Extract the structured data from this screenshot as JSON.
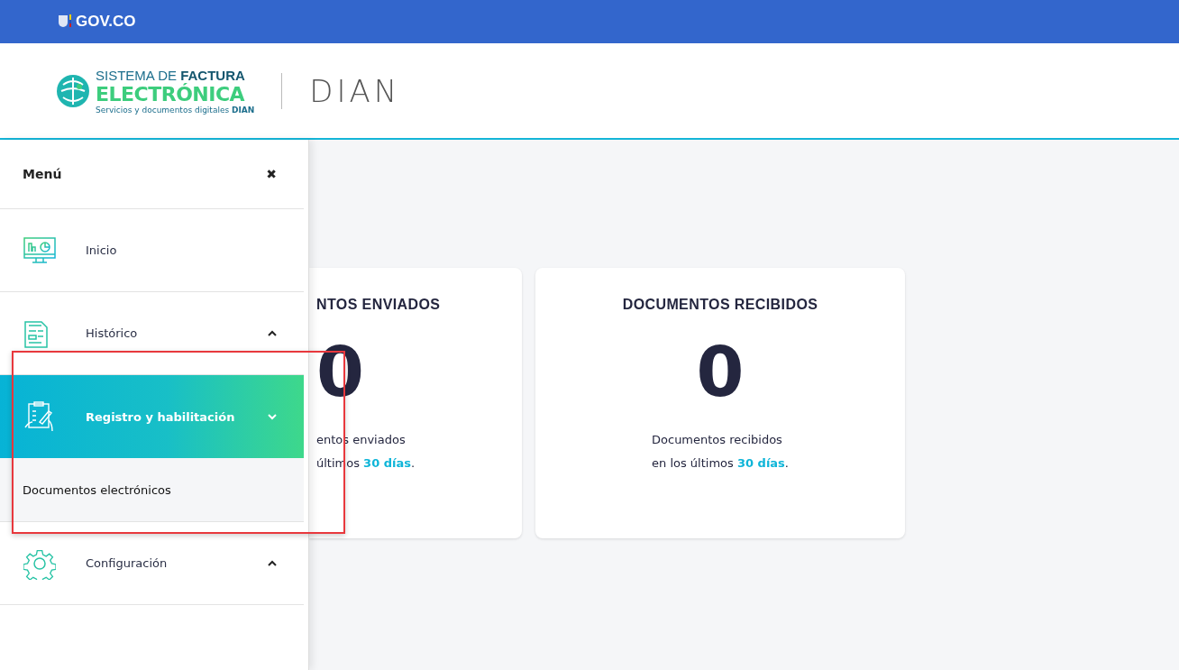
{
  "gov_bar": {
    "label": "GOV.CO"
  },
  "header": {
    "logo_line_1": "SISTEMA DE **FACTURA**",
    "logo_line_2": "ELECTRÓNICA",
    "logo_line_3": "Servicios y documentos digitales **DIAN**",
    "brand": "DIAN"
  },
  "menu": {
    "title": "Menú",
    "close": "✖",
    "items": [
      {
        "label": "Inicio",
        "kind": "link",
        "selected": false
      },
      {
        "label": "Histórico",
        "kind": "group",
        "selected": false,
        "expanded": false
      },
      {
        "label": "Registro y habilitación",
        "kind": "group",
        "selected": true,
        "expanded": true,
        "children": [
          {
            "label": "Documentos electrónicos"
          }
        ]
      },
      {
        "label": "Configuración",
        "kind": "group",
        "selected": false,
        "expanded": false
      }
    ]
  },
  "cards": [
    {
      "title": "NTOS ENVIADOS",
      "value": "0",
      "caption_1": "entos enviados",
      "caption_2": "últimos **30 días**.",
      "clipped": true
    },
    {
      "title": "DOCUMENTOS RECIBIDOS",
      "value": "0",
      "caption_1": "Documentos recibidos",
      "caption_2": "en los últimos **30 días**.",
      "clipped": false
    }
  ]
}
